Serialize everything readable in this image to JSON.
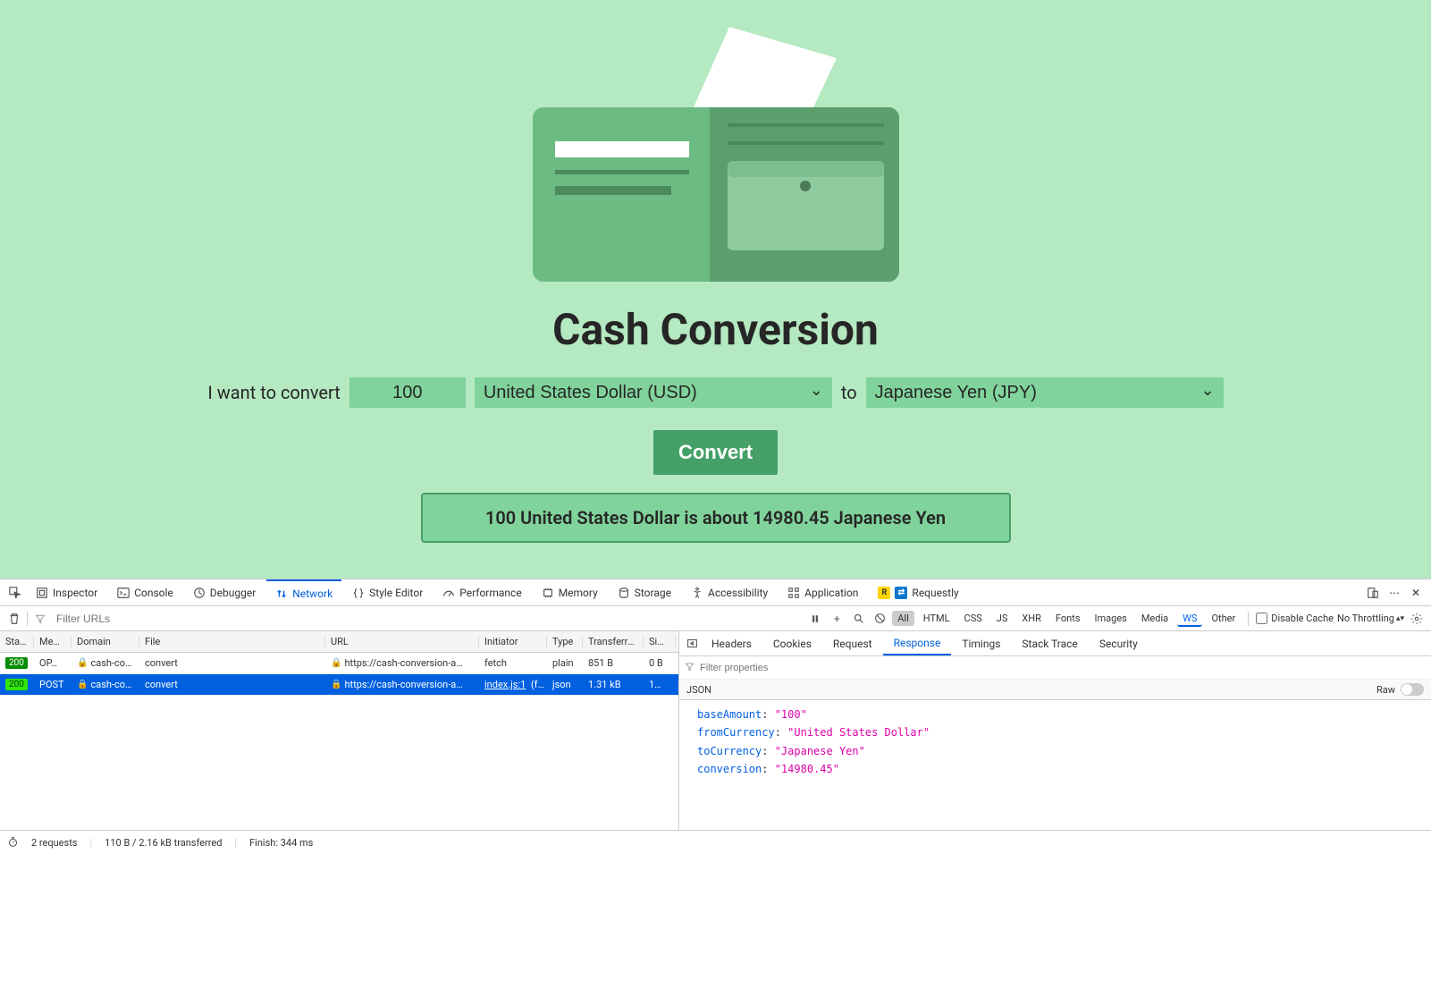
{
  "app": {
    "title": "Cash Conversion",
    "form": {
      "prefix": "I want to convert",
      "amount": "100",
      "from_currency": "United States Dollar (USD)",
      "to_label": "to",
      "to_currency": "Japanese Yen (JPY)",
      "button": "Convert"
    },
    "result": "100 United States Dollar is about 14980.45 Japanese Yen"
  },
  "devtools": {
    "tabs": {
      "inspector": "Inspector",
      "console": "Console",
      "debugger": "Debugger",
      "network": "Network",
      "style_editor": "Style Editor",
      "performance": "Performance",
      "memory": "Memory",
      "storage": "Storage",
      "accessibility": "Accessibility",
      "application": "Application",
      "requestly": "Requestly"
    },
    "toolbar": {
      "filter_placeholder": "Filter URLs",
      "chips": {
        "all": "All",
        "html": "HTML",
        "css": "CSS",
        "js": "JS",
        "xhr": "XHR",
        "fonts": "Fonts",
        "images": "Images",
        "media": "Media",
        "ws": "WS",
        "other": "Other"
      },
      "disable_cache": "Disable Cache",
      "no_throttling": "No Throttling"
    },
    "net_table": {
      "headers": {
        "status": "Stat…",
        "method": "Me…",
        "domain": "Domain",
        "file": "File",
        "url": "URL",
        "initiator": "Initiator",
        "type": "Type",
        "transferred": "Transferred",
        "size": "Si…"
      },
      "rows": [
        {
          "status": "200",
          "method": "OP…",
          "domain": "cash-co…",
          "file": "convert",
          "url": "https://cash-conversion-a…",
          "initiator": "fetch",
          "type": "plain",
          "transferred": "851 B",
          "size": "0 B",
          "selected": false
        },
        {
          "status": "200",
          "method": "POST",
          "domain": "cash-co…",
          "file": "convert",
          "url": "https://cash-conversion-a…",
          "initiator": "index.js:1 (f…",
          "initiator_link": "index.js:1",
          "type": "json",
          "transferred": "1.31 kB",
          "size": "1…",
          "selected": true
        }
      ]
    },
    "details": {
      "tabs": {
        "headers": "Headers",
        "cookies": "Cookies",
        "request": "Request",
        "response": "Response",
        "timings": "Timings",
        "stack_trace": "Stack Trace",
        "security": "Security"
      },
      "filter_placeholder": "Filter properties",
      "json_label": "JSON",
      "raw_label": "Raw",
      "json": [
        {
          "key": "baseAmount",
          "value": "\"100\""
        },
        {
          "key": "fromCurrency",
          "value": "\"United States Dollar\""
        },
        {
          "key": "toCurrency",
          "value": "\"Japanese Yen\""
        },
        {
          "key": "conversion",
          "value": "\"14980.45\""
        }
      ]
    },
    "footer": {
      "requests": "2 requests",
      "transferred": "110 B / 2.16 kB transferred",
      "finish": "Finish: 344 ms"
    }
  }
}
